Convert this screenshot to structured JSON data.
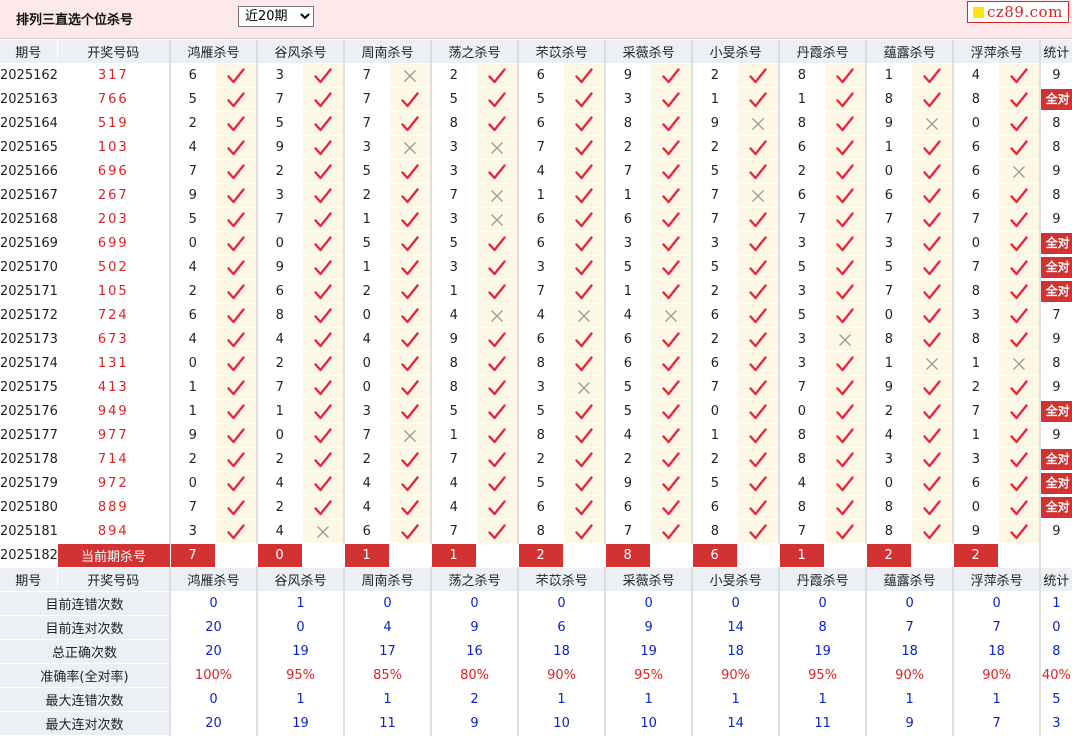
{
  "header": {
    "title": "排列三直选个位杀号",
    "period_select": {
      "selected": "近20期",
      "options": [
        "近20期"
      ]
    },
    "logo_text": "cz89.com"
  },
  "columns": {
    "period": "期号",
    "draw": "开奖号码",
    "experts": [
      "鸿雁杀号",
      "谷风杀号",
      "周南杀号",
      "荡之杀号",
      "芣苡杀号",
      "采薇杀号",
      "小旻杀号",
      "丹霞杀号",
      "蕴露杀号",
      "浮萍杀号"
    ],
    "stat": "统计"
  },
  "full_label": "全对",
  "rows": [
    {
      "period": "2025162",
      "draw": "317",
      "k": [
        6,
        3,
        7,
        2,
        6,
        9,
        2,
        8,
        1,
        4
      ],
      "h": [
        1,
        1,
        0,
        1,
        1,
        1,
        1,
        1,
        1,
        1
      ],
      "stat": "9"
    },
    {
      "period": "2025163",
      "draw": "766",
      "k": [
        5,
        7,
        7,
        5,
        5,
        3,
        1,
        1,
        8,
        8
      ],
      "h": [
        1,
        1,
        1,
        1,
        1,
        1,
        1,
        1,
        1,
        1
      ],
      "stat": "全对"
    },
    {
      "period": "2025164",
      "draw": "519",
      "k": [
        2,
        5,
        7,
        8,
        6,
        8,
        9,
        8,
        9,
        0
      ],
      "h": [
        1,
        1,
        1,
        1,
        1,
        1,
        0,
        1,
        0,
        1
      ],
      "stat": "8"
    },
    {
      "period": "2025165",
      "draw": "103",
      "k": [
        4,
        9,
        3,
        3,
        7,
        2,
        2,
        6,
        1,
        6
      ],
      "h": [
        1,
        1,
        0,
        0,
        1,
        1,
        1,
        1,
        1,
        1
      ],
      "stat": "8"
    },
    {
      "period": "2025166",
      "draw": "696",
      "k": [
        7,
        2,
        5,
        3,
        4,
        7,
        5,
        2,
        0,
        6
      ],
      "h": [
        1,
        1,
        1,
        1,
        1,
        1,
        1,
        1,
        1,
        0
      ],
      "stat": "9"
    },
    {
      "period": "2025167",
      "draw": "267",
      "k": [
        9,
        3,
        2,
        7,
        1,
        1,
        7,
        6,
        6,
        6
      ],
      "h": [
        1,
        1,
        1,
        0,
        1,
        1,
        0,
        1,
        1,
        1
      ],
      "stat": "8"
    },
    {
      "period": "2025168",
      "draw": "203",
      "k": [
        5,
        7,
        1,
        3,
        6,
        6,
        7,
        7,
        7,
        7
      ],
      "h": [
        1,
        1,
        1,
        0,
        1,
        1,
        1,
        1,
        1,
        1
      ],
      "stat": "9"
    },
    {
      "period": "2025169",
      "draw": "699",
      "k": [
        0,
        0,
        5,
        5,
        6,
        3,
        3,
        3,
        3,
        0
      ],
      "h": [
        1,
        1,
        1,
        1,
        1,
        1,
        1,
        1,
        1,
        1
      ],
      "stat": "全对"
    },
    {
      "period": "2025170",
      "draw": "502",
      "k": [
        4,
        9,
        1,
        3,
        3,
        5,
        5,
        5,
        5,
        7
      ],
      "h": [
        1,
        1,
        1,
        1,
        1,
        1,
        1,
        1,
        1,
        1
      ],
      "stat": "全对"
    },
    {
      "period": "2025171",
      "draw": "105",
      "k": [
        2,
        6,
        2,
        1,
        7,
        1,
        2,
        3,
        7,
        8
      ],
      "h": [
        1,
        1,
        1,
        1,
        1,
        1,
        1,
        1,
        1,
        1
      ],
      "stat": "全对"
    },
    {
      "period": "2025172",
      "draw": "724",
      "k": [
        6,
        8,
        0,
        4,
        4,
        4,
        6,
        5,
        0,
        3
      ],
      "h": [
        1,
        1,
        1,
        0,
        0,
        0,
        1,
        1,
        1,
        1
      ],
      "stat": "7"
    },
    {
      "period": "2025173",
      "draw": "673",
      "k": [
        4,
        4,
        4,
        9,
        6,
        6,
        2,
        3,
        8,
        8
      ],
      "h": [
        1,
        1,
        1,
        1,
        1,
        1,
        1,
        0,
        1,
        1
      ],
      "stat": "9"
    },
    {
      "period": "2025174",
      "draw": "131",
      "k": [
        0,
        2,
        0,
        8,
        8,
        6,
        6,
        3,
        1,
        1
      ],
      "h": [
        1,
        1,
        1,
        1,
        1,
        1,
        1,
        1,
        0,
        0
      ],
      "stat": "8"
    },
    {
      "period": "2025175",
      "draw": "413",
      "k": [
        1,
        7,
        0,
        8,
        3,
        5,
        7,
        7,
        9,
        2
      ],
      "h": [
        1,
        1,
        1,
        1,
        0,
        1,
        1,
        1,
        1,
        1
      ],
      "stat": "9"
    },
    {
      "period": "2025176",
      "draw": "949",
      "k": [
        1,
        1,
        3,
        5,
        5,
        5,
        0,
        0,
        2,
        7
      ],
      "h": [
        1,
        1,
        1,
        1,
        1,
        1,
        1,
        1,
        1,
        1
      ],
      "stat": "全对"
    },
    {
      "period": "2025177",
      "draw": "977",
      "k": [
        9,
        0,
        7,
        1,
        8,
        4,
        1,
        8,
        4,
        1
      ],
      "h": [
        1,
        1,
        0,
        1,
        1,
        1,
        1,
        1,
        1,
        1
      ],
      "stat": "9"
    },
    {
      "period": "2025178",
      "draw": "714",
      "k": [
        2,
        2,
        2,
        7,
        2,
        2,
        2,
        8,
        3,
        3
      ],
      "h": [
        1,
        1,
        1,
        1,
        1,
        1,
        1,
        1,
        1,
        1
      ],
      "stat": "全对"
    },
    {
      "period": "2025179",
      "draw": "972",
      "k": [
        0,
        4,
        4,
        4,
        5,
        9,
        5,
        4,
        0,
        6
      ],
      "h": [
        1,
        1,
        1,
        1,
        1,
        1,
        1,
        1,
        1,
        1
      ],
      "stat": "全对"
    },
    {
      "period": "2025180",
      "draw": "889",
      "k": [
        7,
        2,
        4,
        4,
        6,
        6,
        6,
        8,
        8,
        0
      ],
      "h": [
        1,
        1,
        1,
        1,
        1,
        1,
        1,
        1,
        1,
        1
      ],
      "stat": "全对"
    },
    {
      "period": "2025181",
      "draw": "894",
      "k": [
        3,
        4,
        6,
        7,
        8,
        7,
        8,
        7,
        8,
        9
      ],
      "h": [
        1,
        0,
        1,
        1,
        1,
        1,
        1,
        1,
        1,
        1
      ],
      "stat": "9"
    }
  ],
  "current": {
    "period": "2025182",
    "label": "当前期杀号",
    "kills": [
      "7",
      "0",
      "1",
      "1",
      "2",
      "8",
      "6",
      "1",
      "2",
      "2"
    ]
  },
  "summary": [
    {
      "label": "目前连错次数",
      "values": [
        "0",
        "1",
        "0",
        "0",
        "0",
        "0",
        "0",
        "0",
        "0",
        "0"
      ],
      "stat": "1"
    },
    {
      "label": "目前连对次数",
      "values": [
        "20",
        "0",
        "4",
        "9",
        "6",
        "9",
        "14",
        "8",
        "7",
        "7"
      ],
      "stat": "0"
    },
    {
      "label": "总正确次数",
      "values": [
        "20",
        "19",
        "17",
        "16",
        "18",
        "19",
        "18",
        "19",
        "18",
        "18"
      ],
      "stat": "8"
    },
    {
      "label": "准确率(全对率)",
      "values": [
        "100%",
        "95%",
        "85%",
        "80%",
        "90%",
        "95%",
        "90%",
        "95%",
        "90%",
        "90%"
      ],
      "stat": "40%"
    },
    {
      "label": "最大连错次数",
      "values": [
        "0",
        "1",
        "1",
        "2",
        "1",
        "1",
        "1",
        "1",
        "1",
        "1"
      ],
      "stat": "5"
    },
    {
      "label": "最大连对次数",
      "values": [
        "20",
        "19",
        "11",
        "9",
        "10",
        "10",
        "14",
        "11",
        "9",
        "7"
      ],
      "stat": "3"
    }
  ],
  "colors": {
    "accent_red": "#d33232",
    "header_bg": "#eceff4",
    "mark_bg": "#fdf7e6",
    "summary_blue": "#0b22c6"
  },
  "icons": {
    "hit": "check-icon",
    "miss": "cross-icon"
  }
}
